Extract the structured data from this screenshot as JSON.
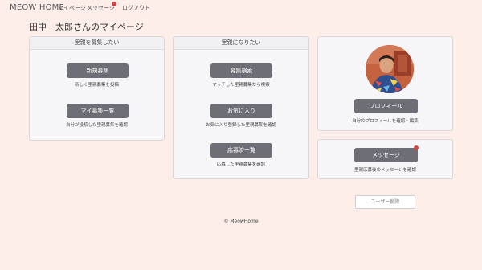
{
  "nav": {
    "brand": "MEOW HOME",
    "mypage": "マイページ",
    "messages": "メッセージ",
    "logout": "ログアウト"
  },
  "page": {
    "title": "田中　太郎さんのマイページ"
  },
  "recruit_card": {
    "header": "里親を募集したい",
    "new_button": "新規募集",
    "new_desc": "新しく里親募集を投稿",
    "list_button": "マイ募集一覧",
    "list_desc": "自分が投稿した里親募集を確認"
  },
  "adopt_card": {
    "header": "里親になりたい",
    "search_button": "募集検索",
    "search_desc": "マッチした里親募集から検索",
    "favorites_button": "お気に入り",
    "favorites_desc": "お気に入り登録した里親募集を確認",
    "applied_button": "応募済一覧",
    "applied_desc": "応募した里親募集を確認"
  },
  "profile_card": {
    "button": "プロフィール",
    "desc": "自分のプロフィールを確認・編集"
  },
  "message_card": {
    "button": "メッセージ",
    "desc": "里親応募後のメッセージを確認"
  },
  "delete_button": "ユーザー削除",
  "footer": "© MeowHome",
  "colors": {
    "background": "#fdeee9",
    "button": "#6e6e76",
    "notification": "#d64545"
  }
}
